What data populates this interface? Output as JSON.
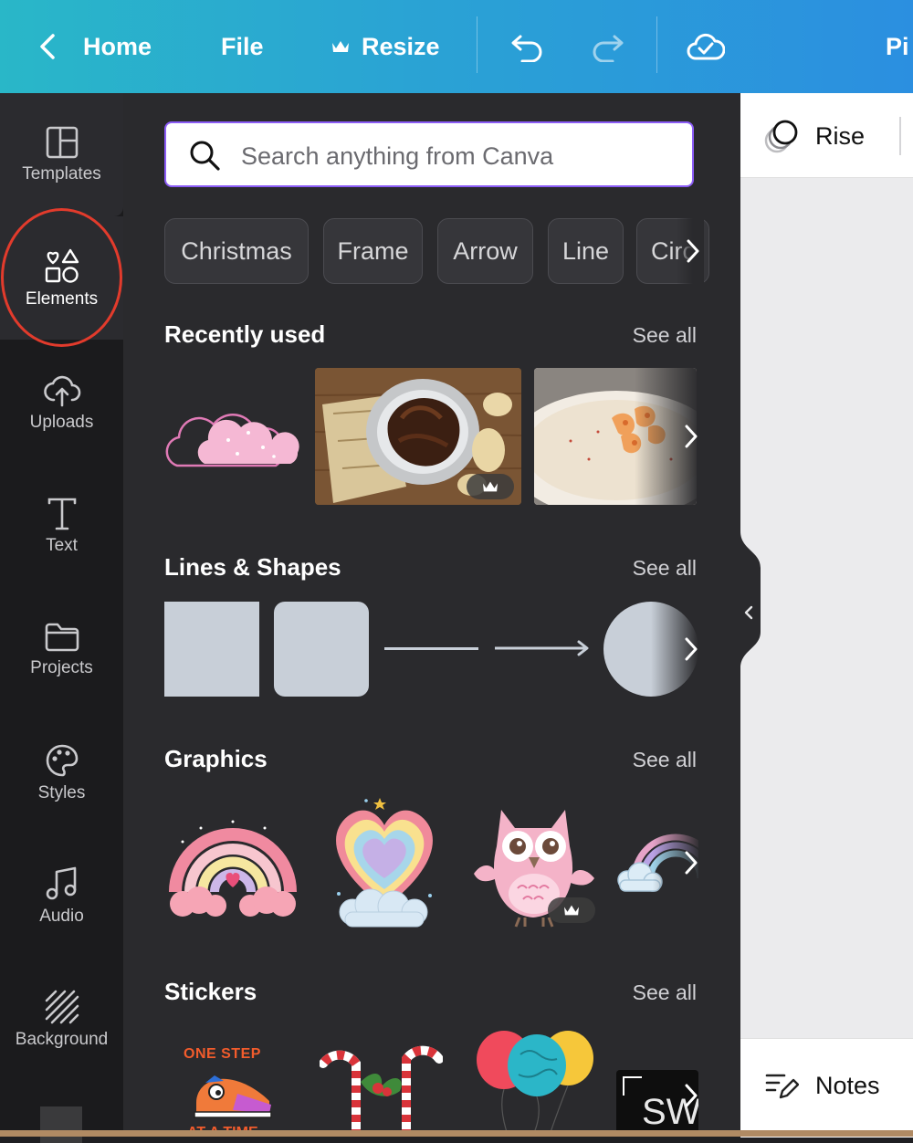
{
  "topbar": {
    "home_label": "Home",
    "file_label": "File",
    "resize_label": "Resize",
    "user_truncated": "Pi",
    "icons": [
      "back-chevron-icon",
      "crown-icon",
      "undo-icon",
      "redo-icon",
      "cloud-check-icon"
    ]
  },
  "sidebar": {
    "items": [
      {
        "label": "Templates",
        "icon": "templates-icon"
      },
      {
        "label": "Elements",
        "icon": "elements-icon",
        "active": true
      },
      {
        "label": "Uploads",
        "icon": "upload-cloud-icon"
      },
      {
        "label": "Text",
        "icon": "text-t-icon"
      },
      {
        "label": "Projects",
        "icon": "folder-icon"
      },
      {
        "label": "Styles",
        "icon": "palette-icon"
      },
      {
        "label": "Audio",
        "icon": "music-note-icon"
      },
      {
        "label": "Background",
        "icon": "hatch-pattern-icon"
      }
    ]
  },
  "search": {
    "placeholder": "Search anything from Canva"
  },
  "chips": [
    "Christmas",
    "Frame",
    "Arrow",
    "Line",
    "Circ"
  ],
  "sections": {
    "recently_used": {
      "title": "Recently used",
      "see_all": "See all"
    },
    "lines_shapes": {
      "title": "Lines & Shapes",
      "see_all": "See all"
    },
    "graphics": {
      "title": "Graphics",
      "see_all": "See all"
    },
    "stickers": {
      "title": "Stickers",
      "see_all": "See all",
      "sticker1_line1": "ONE STEP",
      "sticker1_line2": "AT A TIME",
      "sticker4_text": "SW"
    }
  },
  "right_panel": {
    "animation_label": "Rise",
    "notes_label": "Notes"
  },
  "colors": {
    "topbar_start": "#29b7c8",
    "topbar_end": "#2b8fe0",
    "panel_bg": "#2a2a2d",
    "sidebar_bg": "#1b1b1d",
    "search_border": "#8b5cf6",
    "annotation": "#e23b2c",
    "shape_fill": "#c8cfd8"
  }
}
